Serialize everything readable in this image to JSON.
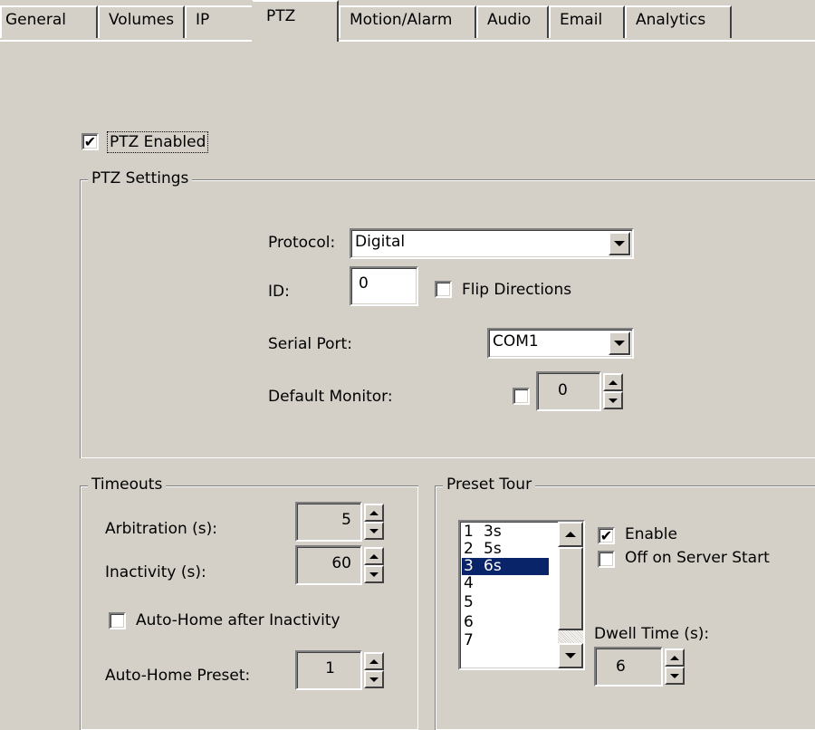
{
  "tabs": [
    {
      "label": "General"
    },
    {
      "label": "Volumes"
    },
    {
      "label": "IP"
    },
    {
      "label": "PTZ",
      "selected": true
    },
    {
      "label": "Motion/Alarm"
    },
    {
      "label": "Audio"
    },
    {
      "label": "Email"
    },
    {
      "label": "Analytics"
    }
  ],
  "ptz_enabled": {
    "label": "PTZ Enabled",
    "checked": true
  },
  "ptz_settings": {
    "title": "PTZ Settings",
    "protocol_label": "Protocol:",
    "protocol_value": "Digital",
    "id_label": "ID:",
    "id_value": "0",
    "flip_label": "Flip Directions",
    "flip_checked": false,
    "serial_port_label": "Serial Port:",
    "serial_port_value": "COM1",
    "default_monitor_label": "Default Monitor:",
    "default_monitor_checked": false,
    "default_monitor_value": "0"
  },
  "timeouts": {
    "title": "Timeouts",
    "arbitration_label": "Arbitration (s):",
    "arbitration_value": "5",
    "inactivity_label": "Inactivity (s):",
    "inactivity_value": "60",
    "auto_home_label": "Auto-Home after Inactivity",
    "auto_home_checked": false,
    "auto_home_preset_label": "Auto-Home Preset:",
    "auto_home_preset_value": "1"
  },
  "preset_tour": {
    "title": "Preset Tour",
    "items": [
      {
        "n": "1",
        "t": "3s"
      },
      {
        "n": "2",
        "t": "5s"
      },
      {
        "n": "3",
        "t": "6s",
        "selected": true
      },
      {
        "n": "4",
        "t": ""
      },
      {
        "n": "5",
        "t": ""
      },
      {
        "n": "6",
        "t": ""
      },
      {
        "n": "7",
        "t": ""
      }
    ],
    "enable_label": "Enable",
    "enable_checked": true,
    "off_on_start_label": "Off on Server Start",
    "off_on_start_checked": false,
    "dwell_label": "Dwell Time (s):",
    "dwell_value": "6"
  },
  "colors": {
    "face": "#d4d0c8",
    "selection": "#0a246a"
  }
}
